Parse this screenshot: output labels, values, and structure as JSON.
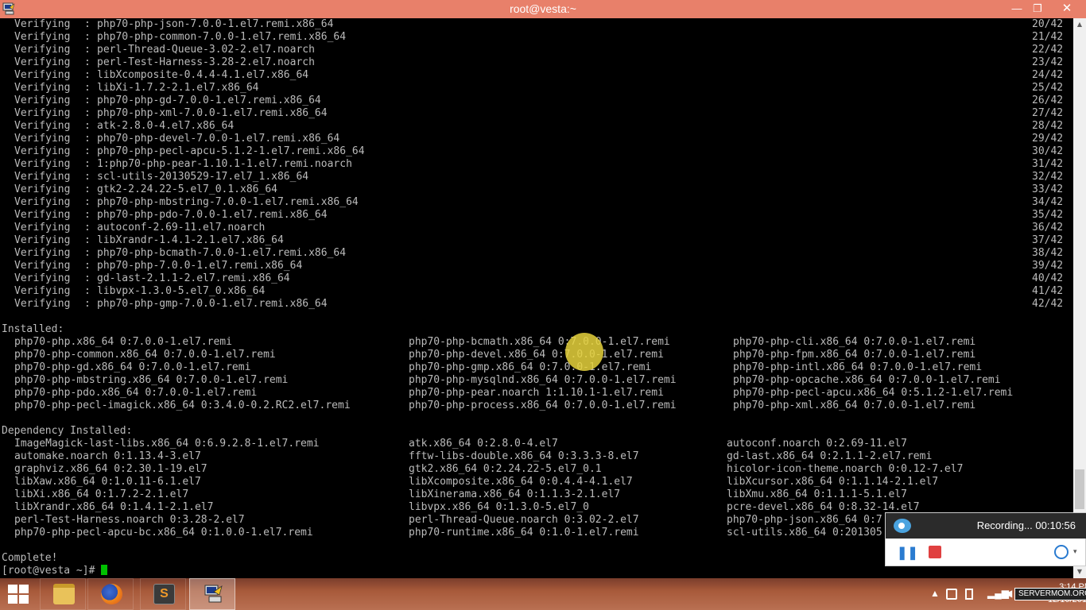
{
  "window": {
    "title": "root@vesta:~",
    "minimize_glyph": "—",
    "maximize_glyph": "❐",
    "close_glyph": "✕"
  },
  "terminal": {
    "verifying": [
      {
        "label": "Verifying",
        "package": "php70-php-json-7.0.0-1.el7.remi.x86_64",
        "progress": "20/42"
      },
      {
        "label": "Verifying",
        "package": "php70-php-common-7.0.0-1.el7.remi.x86_64",
        "progress": "21/42"
      },
      {
        "label": "Verifying",
        "package": "perl-Thread-Queue-3.02-2.el7.noarch",
        "progress": "22/42"
      },
      {
        "label": "Verifying",
        "package": "perl-Test-Harness-3.28-2.el7.noarch",
        "progress": "23/42"
      },
      {
        "label": "Verifying",
        "package": "libXcomposite-0.4.4-4.1.el7.x86_64",
        "progress": "24/42"
      },
      {
        "label": "Verifying",
        "package": "libXi-1.7.2-2.1.el7.x86_64",
        "progress": "25/42"
      },
      {
        "label": "Verifying",
        "package": "php70-php-gd-7.0.0-1.el7.remi.x86_64",
        "progress": "26/42"
      },
      {
        "label": "Verifying",
        "package": "php70-php-xml-7.0.0-1.el7.remi.x86_64",
        "progress": "27/42"
      },
      {
        "label": "Verifying",
        "package": "atk-2.8.0-4.el7.x86_64",
        "progress": "28/42"
      },
      {
        "label": "Verifying",
        "package": "php70-php-devel-7.0.0-1.el7.remi.x86_64",
        "progress": "29/42"
      },
      {
        "label": "Verifying",
        "package": "php70-php-pecl-apcu-5.1.2-1.el7.remi.x86_64",
        "progress": "30/42"
      },
      {
        "label": "Verifying",
        "package": "1:php70-php-pear-1.10.1-1.el7.remi.noarch",
        "progress": "31/42"
      },
      {
        "label": "Verifying",
        "package": "scl-utils-20130529-17.el7_1.x86_64",
        "progress": "32/42"
      },
      {
        "label": "Verifying",
        "package": "gtk2-2.24.22-5.el7_0.1.x86_64",
        "progress": "33/42"
      },
      {
        "label": "Verifying",
        "package": "php70-php-mbstring-7.0.0-1.el7.remi.x86_64",
        "progress": "34/42"
      },
      {
        "label": "Verifying",
        "package": "php70-php-pdo-7.0.0-1.el7.remi.x86_64",
        "progress": "35/42"
      },
      {
        "label": "Verifying",
        "package": "autoconf-2.69-11.el7.noarch",
        "progress": "36/42"
      },
      {
        "label": "Verifying",
        "package": "libXrandr-1.4.1-2.1.el7.x86_64",
        "progress": "37/42"
      },
      {
        "label": "Verifying",
        "package": "php70-php-bcmath-7.0.0-1.el7.remi.x86_64",
        "progress": "38/42"
      },
      {
        "label": "Verifying",
        "package": "php70-php-7.0.0-1.el7.remi.x86_64",
        "progress": "39/42"
      },
      {
        "label": "Verifying",
        "package": "gd-last-2.1.1-2.el7.remi.x86_64",
        "progress": "40/42"
      },
      {
        "label": "Verifying",
        "package": "libvpx-1.3.0-5.el7_0.x86_64",
        "progress": "41/42"
      },
      {
        "label": "Verifying",
        "package": "php70-php-gmp-7.0.0-1.el7.remi.x86_64",
        "progress": "42/42"
      }
    ],
    "installed_header": "Installed:",
    "installed": [
      [
        "php70-php.x86_64 0:7.0.0-1.el7.remi",
        "php70-php-bcmath.x86_64 0:7.0.0-1.el7.remi",
        "php70-php-cli.x86_64 0:7.0.0-1.el7.remi"
      ],
      [
        "php70-php-common.x86_64 0:7.0.0-1.el7.remi",
        "php70-php-devel.x86_64 0:7.0.0-1.el7.remi",
        "php70-php-fpm.x86_64 0:7.0.0-1.el7.remi"
      ],
      [
        "php70-php-gd.x86_64 0:7.0.0-1.el7.remi",
        "php70-php-gmp.x86_64 0:7.0.0-1.el7.remi",
        "php70-php-intl.x86_64 0:7.0.0-1.el7.remi"
      ],
      [
        "php70-php-mbstring.x86_64 0:7.0.0-1.el7.remi",
        "php70-php-mysqlnd.x86_64 0:7.0.0-1.el7.remi",
        "php70-php-opcache.x86_64 0:7.0.0-1.el7.remi"
      ],
      [
        "php70-php-pdo.x86_64 0:7.0.0-1.el7.remi",
        "php70-php-pear.noarch 1:1.10.1-1.el7.remi",
        "php70-php-pecl-apcu.x86_64 0:5.1.2-1.el7.remi"
      ],
      [
        "php70-php-pecl-imagick.x86_64 0:3.4.0-0.2.RC2.el7.remi",
        "php70-php-process.x86_64 0:7.0.0-1.el7.remi",
        "php70-php-xml.x86_64 0:7.0.0-1.el7.remi"
      ]
    ],
    "dependency_header": "Dependency Installed:",
    "dependencies": [
      [
        "ImageMagick-last-libs.x86_64 0:6.9.2.8-1.el7.remi",
        "atk.x86_64 0:2.8.0-4.el7",
        "autoconf.noarch 0:2.69-11.el7"
      ],
      [
        "automake.noarch 0:1.13.4-3.el7",
        "fftw-libs-double.x86_64 0:3.3.3-8.el7",
        "gd-last.x86_64 0:2.1.1-2.el7.remi"
      ],
      [
        "graphviz.x86_64 0:2.30.1-19.el7",
        "gtk2.x86_64 0:2.24.22-5.el7_0.1",
        "hicolor-icon-theme.noarch 0:0.12-7.el7"
      ],
      [
        "libXaw.x86_64 0:1.0.11-6.1.el7",
        "libXcomposite.x86_64 0:0.4.4-4.1.el7",
        "libXcursor.x86_64 0:1.1.14-2.1.el7"
      ],
      [
        "libXi.x86_64 0:1.7.2-2.1.el7",
        "libXinerama.x86_64 0:1.1.3-2.1.el7",
        "libXmu.x86_64 0:1.1.1-5.1.el7"
      ],
      [
        "libXrandr.x86_64 0:1.4.1-2.1.el7",
        "libvpx.x86_64 0:1.3.0-5.el7_0",
        "pcre-devel.x86_64 0:8.32-14.el7"
      ],
      [
        "perl-Test-Harness.noarch 0:3.28-2.el7",
        "perl-Thread-Queue.noarch 0:3.02-2.el7",
        "php70-php-json.x86_64 0:7"
      ],
      [
        "php70-php-pecl-apcu-bc.x86_64 0:1.0.0-1.el7.remi",
        "php70-runtime.x86_64 0:1.0-1.el7.remi",
        "scl-utils.x86_64 0:201305"
      ]
    ],
    "complete": "Complete!",
    "prompt": "[root@vesta ~]# "
  },
  "recorder": {
    "status": "Recording... 00:10:56",
    "pause_glyph": "❚❚",
    "dropdown_glyph": "▾"
  },
  "taskbar": {
    "clock_time": "3:14 PM",
    "clock_date": "12/10/2015",
    "watermark": "SERVERMOM.ORG",
    "tray_icons": [
      "show-hidden-icon",
      "network-icon",
      "volume-icon"
    ]
  }
}
